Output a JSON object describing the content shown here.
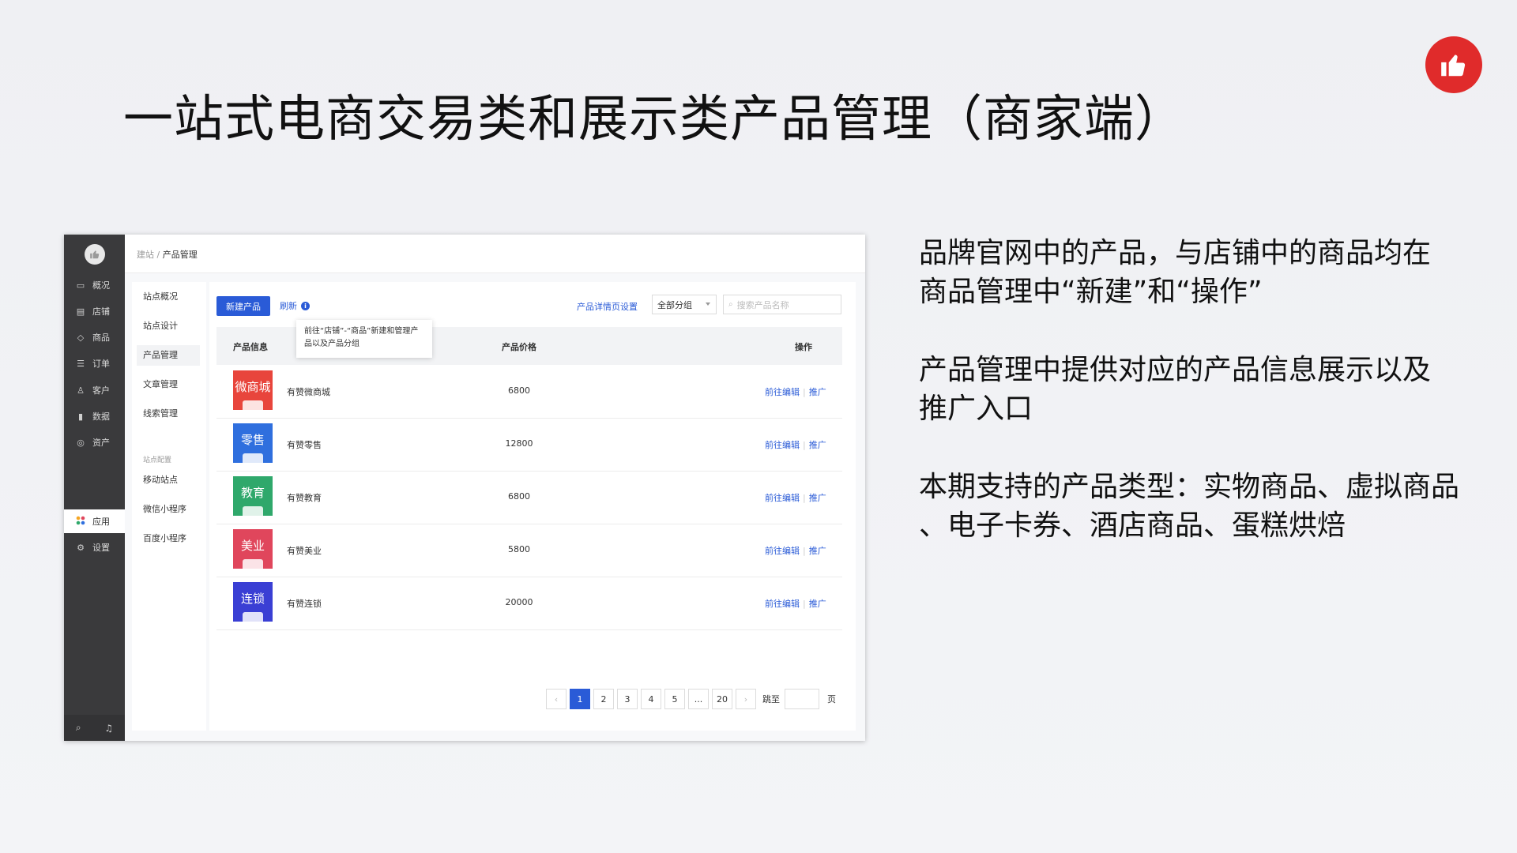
{
  "slide": {
    "title": "一站式电商交易类和展示类产品管理（商家端）",
    "paragraphs": [
      {
        "line1": "品牌官网中的产品，与店铺中的商品均在",
        "line2": "商品管理中“新建”和“操作”"
      },
      {
        "line1": "产品管理中提供对应的产品信息展示以及",
        "line2": "推广入口"
      },
      {
        "line1": "本期支持的产品类型：实物商品、虚拟商品",
        "line2": "、电子卡券、酒店商品、蛋糕烘焙"
      }
    ],
    "badge_icon": "thumbs-up-icon",
    "badge_color": "#e02b2b"
  },
  "app": {
    "sidebar": {
      "items": [
        {
          "label": "概况",
          "icon": "monitor-icon"
        },
        {
          "label": "店铺",
          "icon": "store-icon"
        },
        {
          "label": "商品",
          "icon": "tag-icon"
        },
        {
          "label": "订单",
          "icon": "list-icon"
        },
        {
          "label": "客户",
          "icon": "user-icon"
        },
        {
          "label": "数据",
          "icon": "bar-chart-icon"
        },
        {
          "label": "资产",
          "icon": "coin-icon"
        },
        {
          "label": "应用",
          "icon": "apps-icon"
        },
        {
          "label": "设置",
          "icon": "gear-icon"
        }
      ],
      "active": "应用"
    },
    "breadcrumb": {
      "parent": "建站",
      "separator": "/",
      "current": "产品管理"
    },
    "subnav": {
      "items": [
        "站点概况",
        "站点设计",
        "产品管理",
        "文章管理",
        "线索管理"
      ],
      "active": "产品管理",
      "group_label": "站点配置",
      "group_items": [
        "移动站点",
        "微信小程序",
        "百度小程序"
      ]
    },
    "toolbar": {
      "new_button": "新建产品",
      "refresh": "刷新",
      "tooltip": "前往“店铺”-“商品”新建和管理产品以及产品分组",
      "detail_settings": "产品详情页设置",
      "group_select": "全部分组",
      "search_placeholder": "搜索产品名称"
    },
    "table": {
      "headers": {
        "info": "产品信息",
        "price": "产品价格",
        "ops": "操作"
      },
      "rows": [
        {
          "thumb_text": "微商城",
          "thumb_color": "#e8453c",
          "name": "有赞微商城",
          "price": "6800",
          "edit": "前往编辑",
          "promote": "推广"
        },
        {
          "thumb_text": "零售",
          "thumb_color": "#2f6fde",
          "name": "有赞零售",
          "price": "12800",
          "edit": "前往编辑",
          "promote": "推广"
        },
        {
          "thumb_text": "教育",
          "thumb_color": "#2fa86b",
          "name": "有赞教育",
          "price": "6800",
          "edit": "前往编辑",
          "promote": "推广"
        },
        {
          "thumb_text": "美业",
          "thumb_color": "#e0465c",
          "name": "有赞美业",
          "price": "5800",
          "edit": "前往编辑",
          "promote": "推广"
        },
        {
          "thumb_text": "连锁",
          "thumb_color": "#3a3fd4",
          "name": "有赞连锁",
          "price": "20000",
          "edit": "前往编辑",
          "promote": "推广"
        }
      ]
    },
    "pagination": {
      "pages": [
        "1",
        "2",
        "3",
        "4",
        "5",
        "...",
        "20"
      ],
      "current": "1",
      "jump_label": "跳至",
      "page_suffix": "页"
    },
    "accent_color": "#2a5bd7"
  }
}
